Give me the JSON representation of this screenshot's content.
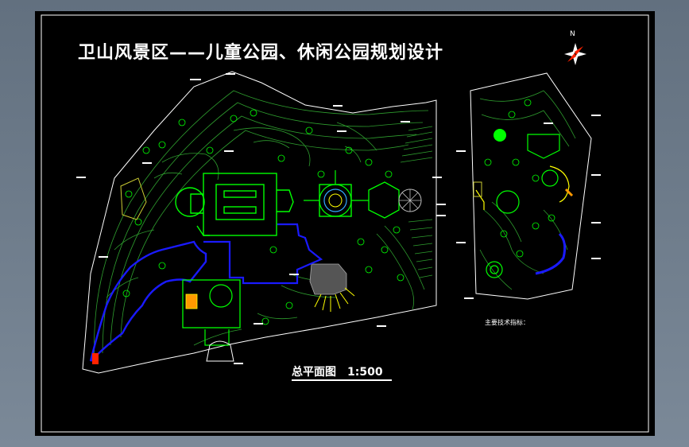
{
  "drawing": {
    "title": "卫山风景区——儿童公园、休闲公园规划设计",
    "scale_label": "总平面图　1:500",
    "tech_label": "主要技术指标：",
    "north_label": "N"
  },
  "colors": {
    "background": "#000000",
    "frame": "#ffffff",
    "contour": "#2e9d2e",
    "structure": "#00ff00",
    "water": "#1a1aff",
    "white": "#ffffff",
    "accent_yellow": "#ffff00",
    "accent_red": "#ff2200",
    "accent_orange": "#ff9900"
  }
}
